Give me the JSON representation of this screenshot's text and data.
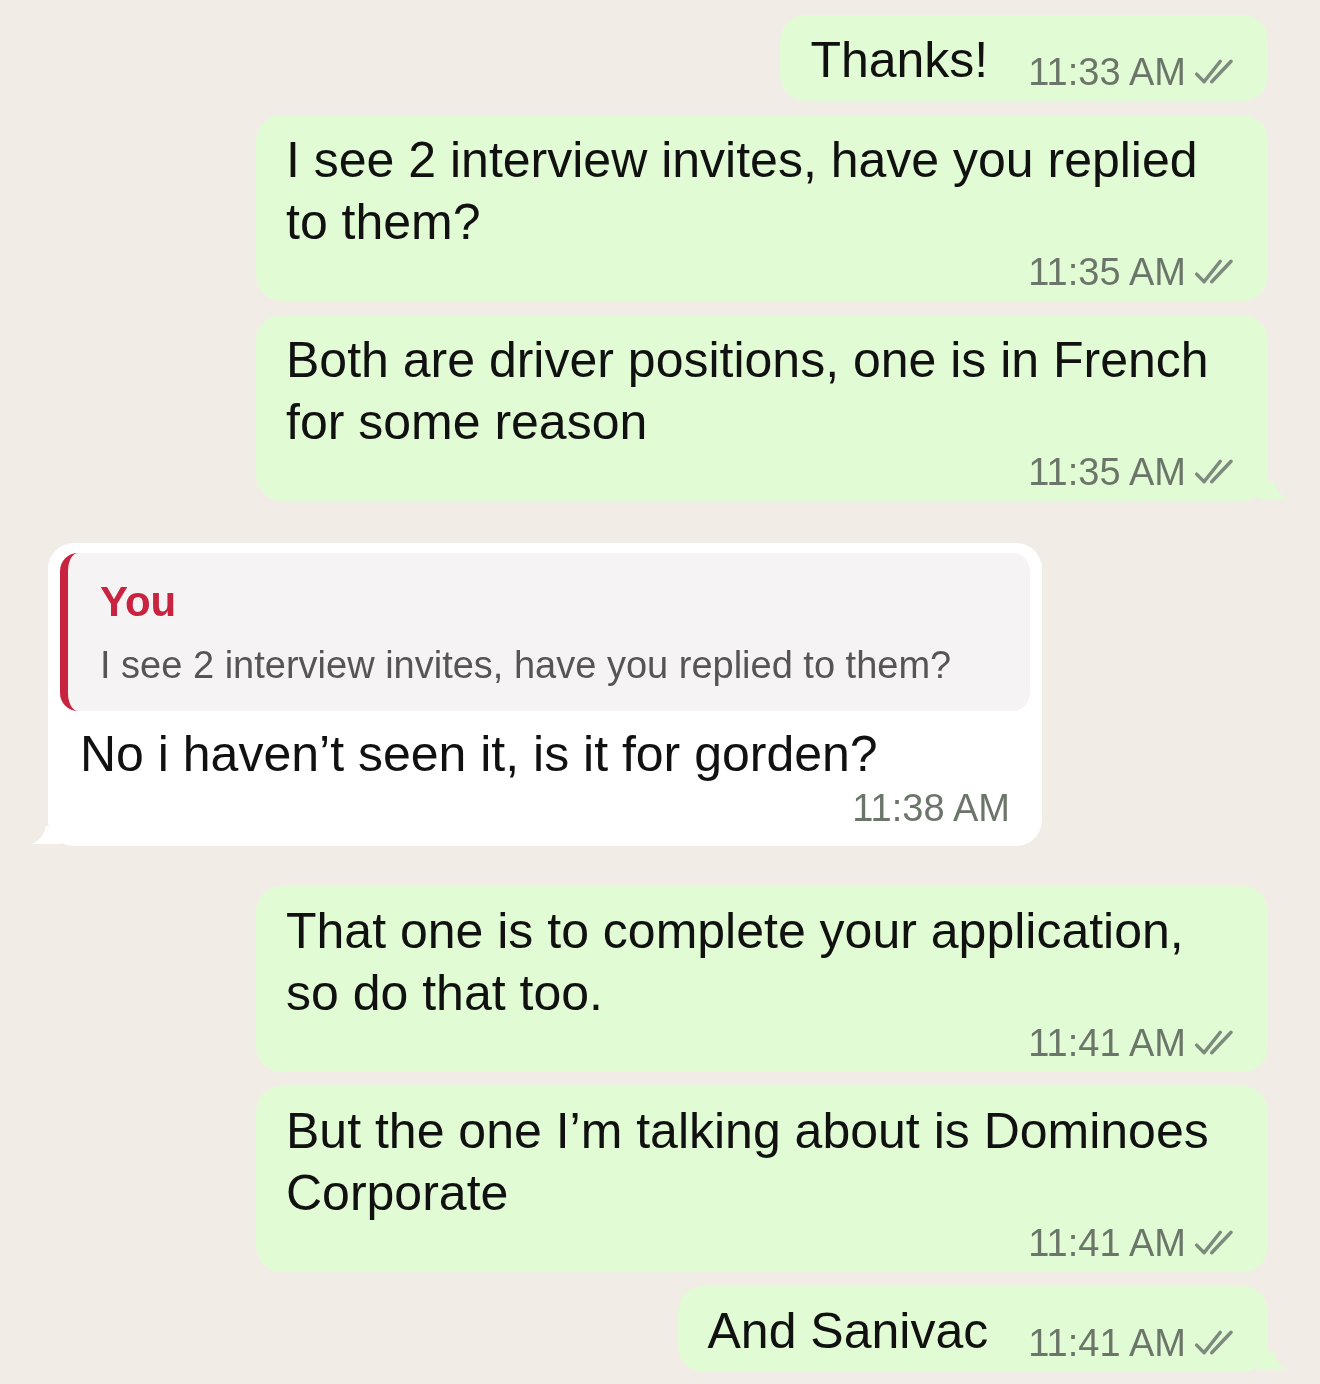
{
  "messages": [
    {
      "kind": "sent",
      "text": "Thanks!",
      "time": "11:33 AM",
      "read": false,
      "tail": false
    },
    {
      "kind": "sent",
      "text": "I see 2 interview invites, have you replied to them?",
      "time": "11:35 AM",
      "read": false,
      "tail": false
    },
    {
      "kind": "sent",
      "text": "Both are driver positions, one is in French for some reason",
      "time": "11:35 AM",
      "read": false,
      "tail": true
    },
    {
      "kind": "received",
      "quote": {
        "author": "You",
        "text": "I see 2 interview invites, have you replied to them?"
      },
      "text": "No i haven’t seen it, is it for gorden?",
      "time": "11:38 AM",
      "tail": true
    },
    {
      "kind": "sent",
      "text": "That one is to complete your application, so do that too.",
      "time": "11:41 AM",
      "read": false,
      "tail": false
    },
    {
      "kind": "sent",
      "text": "But the one I’m talking about is Dominoes Corporate",
      "time": "11:41 AM",
      "read": false,
      "tail": false
    },
    {
      "kind": "sent",
      "text": "And Sanivac",
      "time": "11:41 AM",
      "read": false,
      "tail": true
    }
  ]
}
